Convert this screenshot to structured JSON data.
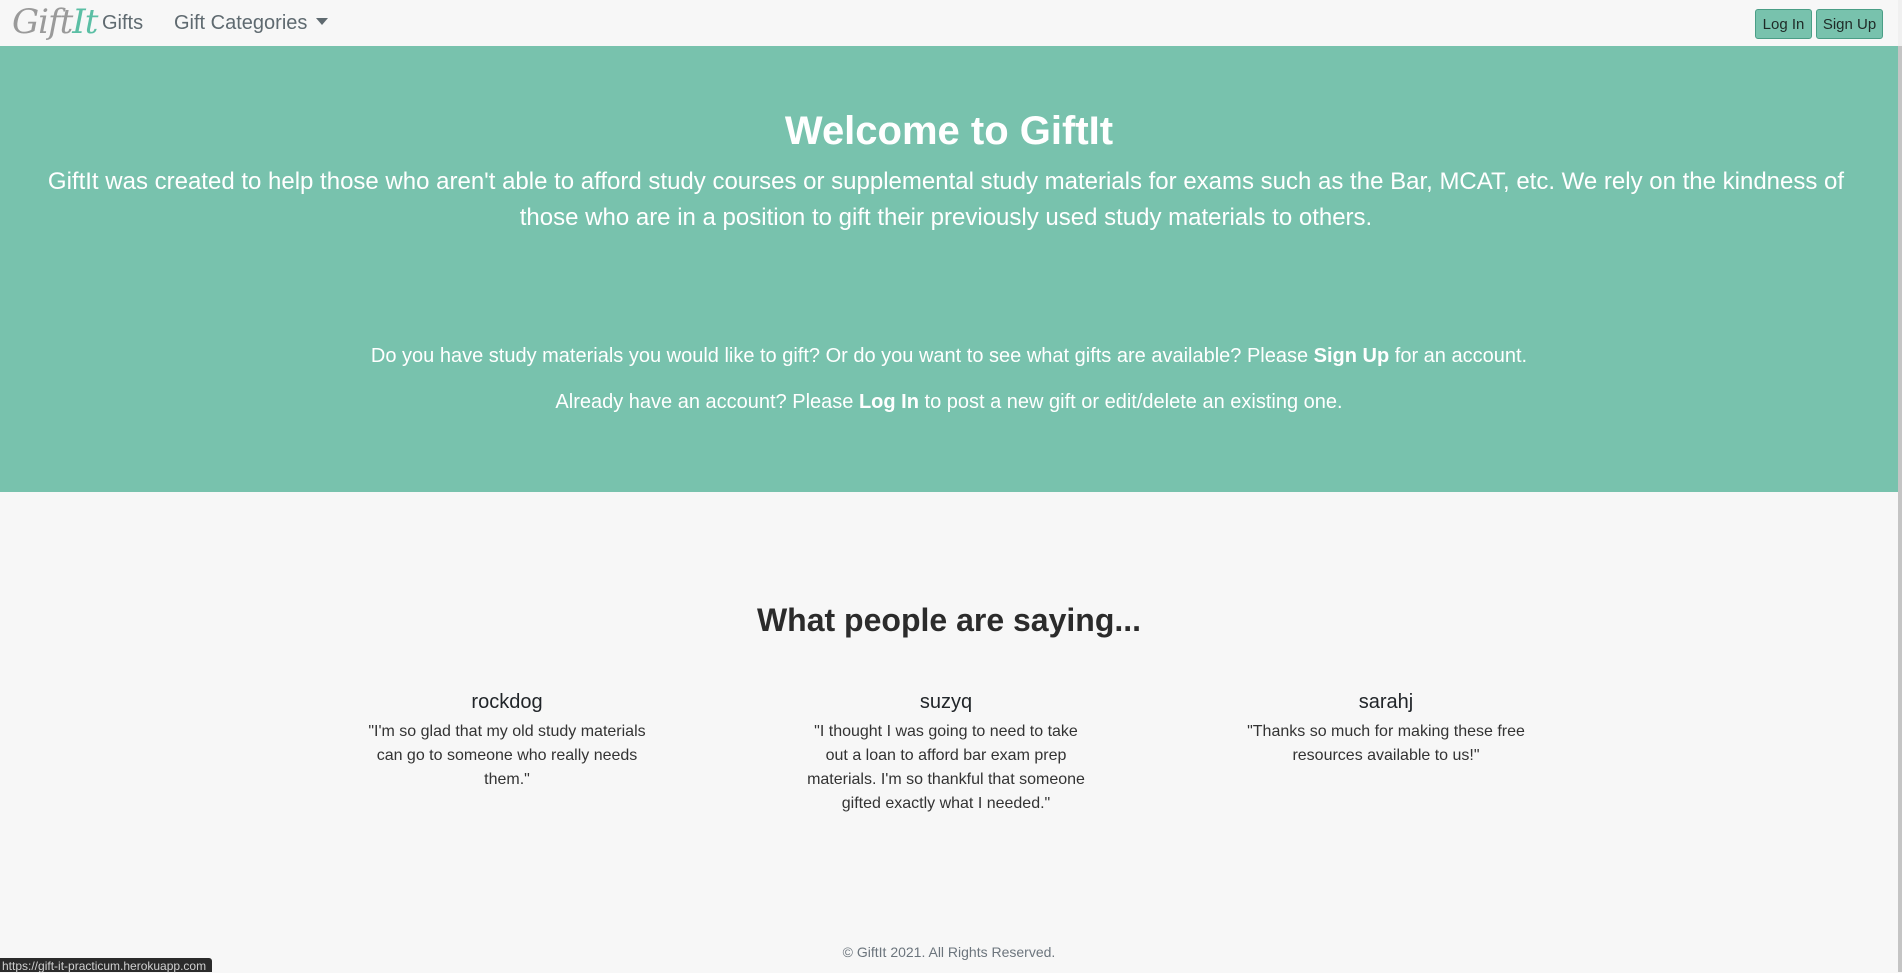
{
  "navbar": {
    "brand": "Gift",
    "brand_accent": "It",
    "gifts_label": "Gifts",
    "categories_label": "Gift Categories",
    "login_label": "Log In",
    "signup_label": "Sign Up"
  },
  "hero": {
    "title": "Welcome to GiftIt",
    "description": "GiftIt was created to help those who aren't able to afford study courses or supplemental study materials for exams such as the Bar, MCAT, etc. We rely on the kindness of those who are in a position to gift their previously used study materials to others.",
    "line1_pre": "Do you have study materials you would like to gift? Or do you want to see what gifts are available? Please ",
    "line1_link": "Sign Up",
    "line1_post": " for an account.",
    "line2_pre": "Already have an account? Please ",
    "line2_link": "Log In",
    "line2_post": " to post a new gift or edit/delete an existing one."
  },
  "testimonials": {
    "title": "What people are saying...",
    "items": [
      {
        "name": "rockdog",
        "quote": "\"I'm so glad that my old study materials can go to someone who really needs them.\""
      },
      {
        "name": "suzyq",
        "quote": "\"I thought I was going to need to take out a loan to afford bar exam prep materials. I'm so thankful that someone gifted exactly what I needed.\""
      },
      {
        "name": "sarahj",
        "quote": "\"Thanks so much for making these free resources available to us!\""
      }
    ]
  },
  "footer": {
    "copyright": "© GiftIt 2021. All Rights Reserved."
  },
  "status_bar": {
    "url": "https://gift-it-practicum.herokuapp.com"
  },
  "colors": {
    "accent": "#78c2ad",
    "background": "#f7f7f7"
  }
}
